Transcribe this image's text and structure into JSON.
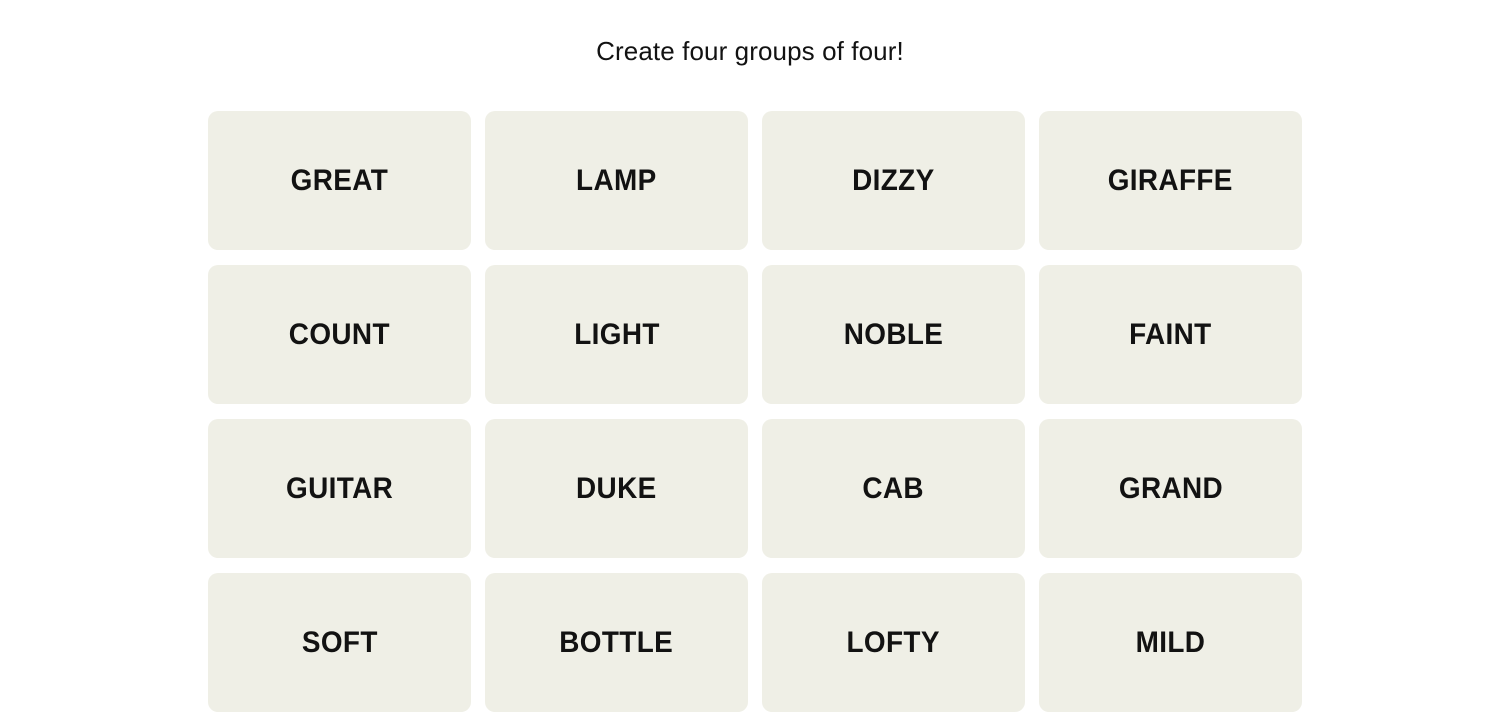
{
  "header": {
    "instruction": "Create four groups of four!"
  },
  "colors": {
    "page_background": "#ffffff",
    "tile_background": "#efefe6",
    "text": "#121212"
  },
  "board": {
    "rows": 4,
    "columns": 4,
    "tiles": [
      {
        "label": "GREAT"
      },
      {
        "label": "LAMP"
      },
      {
        "label": "DIZZY"
      },
      {
        "label": "GIRAFFE"
      },
      {
        "label": "COUNT"
      },
      {
        "label": "LIGHT"
      },
      {
        "label": "NOBLE"
      },
      {
        "label": "FAINT"
      },
      {
        "label": "GUITAR"
      },
      {
        "label": "DUKE"
      },
      {
        "label": "CAB"
      },
      {
        "label": "GRAND"
      },
      {
        "label": "SOFT"
      },
      {
        "label": "BOTTLE"
      },
      {
        "label": "LOFTY"
      },
      {
        "label": "MILD"
      }
    ]
  }
}
